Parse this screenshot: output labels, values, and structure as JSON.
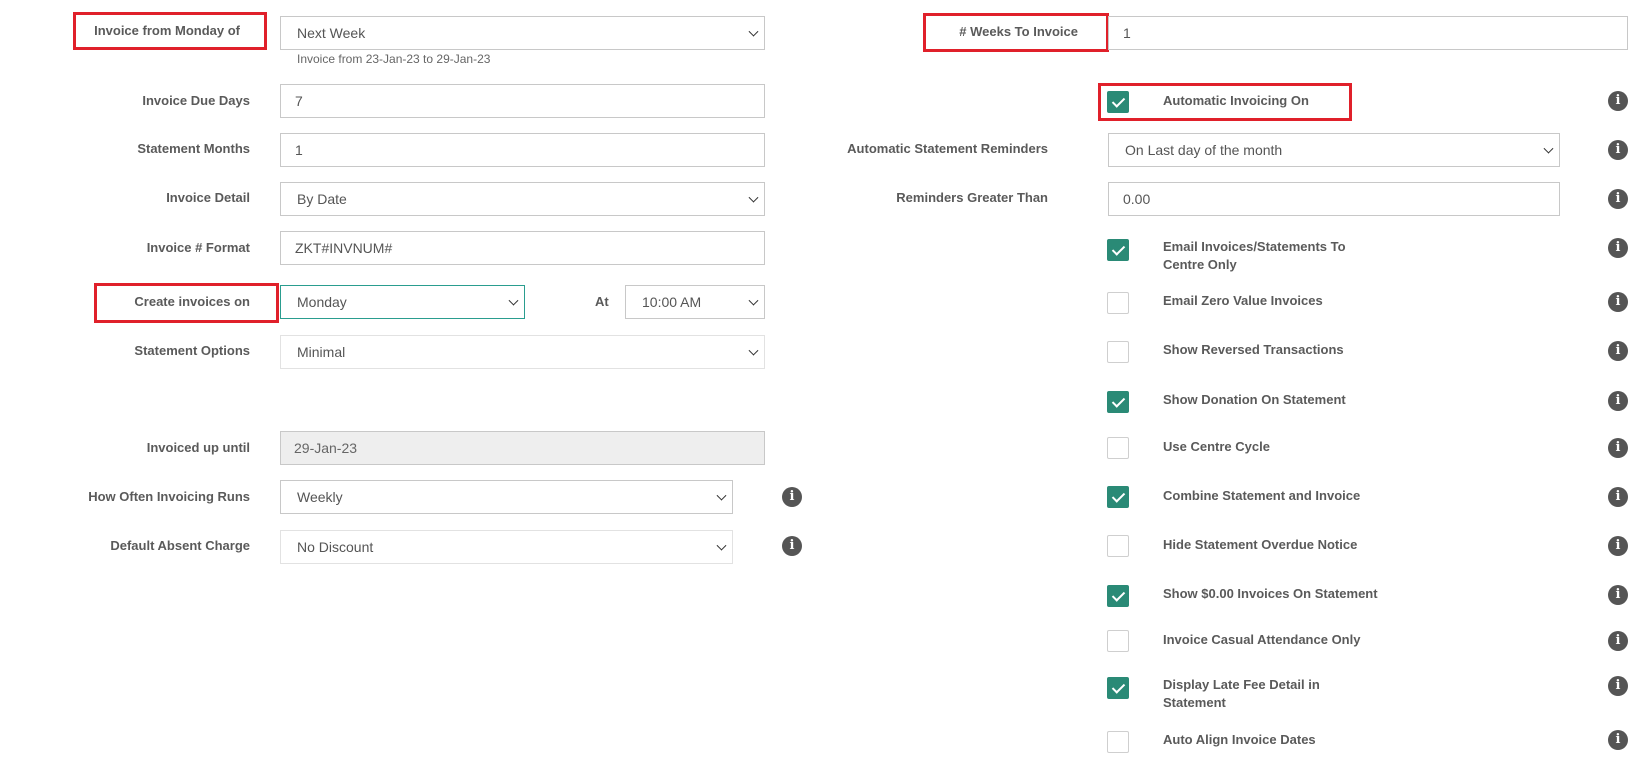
{
  "left": {
    "invoice_from": {
      "label": "Invoice from Monday of",
      "value": "Next Week",
      "hint": "Invoice from 23-Jan-23 to 29-Jan-23"
    },
    "due_days": {
      "label": "Invoice Due Days",
      "value": "7"
    },
    "statement_months": {
      "label": "Statement Months",
      "value": "1"
    },
    "invoice_detail": {
      "label": "Invoice Detail",
      "value": "By Date"
    },
    "invoice_format": {
      "label": "Invoice # Format",
      "value": "ZKT#INVNUM#"
    },
    "create_on": {
      "label": "Create invoices on",
      "value": "Monday",
      "at_label": "At",
      "at_value": "10:00 AM"
    },
    "statement_options": {
      "label": "Statement Options",
      "value": "Minimal"
    },
    "invoiced_until": {
      "label": "Invoiced up until",
      "value": "29-Jan-23"
    },
    "how_often": {
      "label": "How Often Invoicing Runs",
      "value": "Weekly"
    },
    "absent_charge": {
      "label": "Default Absent Charge",
      "value": "No Discount"
    }
  },
  "right": {
    "weeks_to_invoice": {
      "label": "# Weeks To Invoice",
      "value": "1"
    },
    "auto_reminders": {
      "label": "Automatic Statement Reminders",
      "value": "On Last day of the month"
    },
    "reminders_gt": {
      "label": "Reminders Greater Than",
      "value": "0.00"
    },
    "checkboxes": [
      {
        "label": "Automatic Invoicing On",
        "checked": true
      },
      {
        "label": "Email Invoices/Statements To Centre Only",
        "checked": true
      },
      {
        "label": "Email Zero Value Invoices",
        "checked": false
      },
      {
        "label": "Show Reversed Transactions",
        "checked": false
      },
      {
        "label": "Show Donation On Statement",
        "checked": true
      },
      {
        "label": "Use Centre Cycle",
        "checked": false
      },
      {
        "label": "Combine Statement and Invoice",
        "checked": true
      },
      {
        "label": "Hide Statement Overdue Notice",
        "checked": false
      },
      {
        "label": "Show $0.00 Invoices On Statement",
        "checked": true
      },
      {
        "label": "Invoice Casual Attendance Only",
        "checked": false
      },
      {
        "label": "Display Late Fee Detail in Statement",
        "checked": true
      },
      {
        "label": "Auto Align Invoice Dates",
        "checked": false
      }
    ]
  },
  "icons": {
    "info": "info-icon",
    "checkmark": "check-icon",
    "dropdown": "chevron-down-icon"
  },
  "colors": {
    "accent": "#2a8a76",
    "highlight": "#e0202a",
    "info_icon": "#555555"
  }
}
